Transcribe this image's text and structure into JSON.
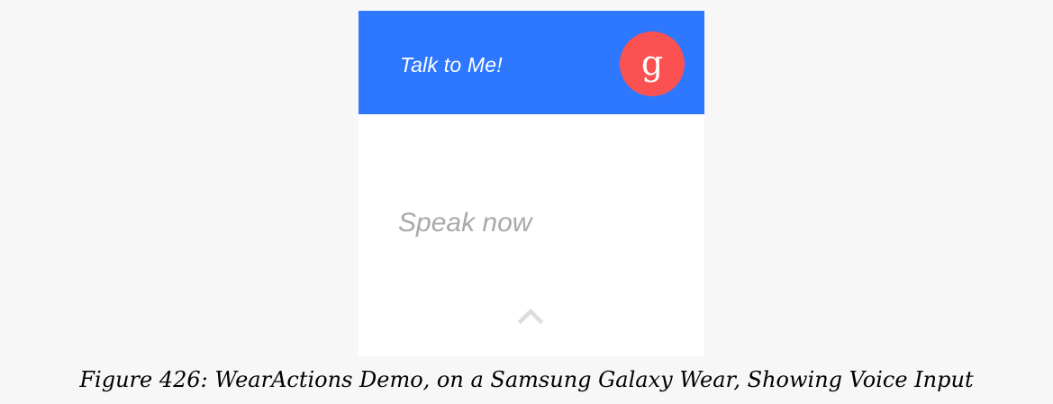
{
  "app": {
    "title": "Talk to Me!",
    "voice_button_glyph": "g",
    "voice_button_icon": "google-voice-icon",
    "prompt": "Speak now",
    "expand_icon": "chevron-up-icon"
  },
  "caption": {
    "text": "Figure 426: WearActions Demo, on a Samsung Galaxy Wear, Showing Voice Input"
  },
  "colors": {
    "header": "#2d78ff",
    "voice_button": "#fb5151",
    "background": "#f7f7f7",
    "prompt_text": "#a9a9a9"
  }
}
